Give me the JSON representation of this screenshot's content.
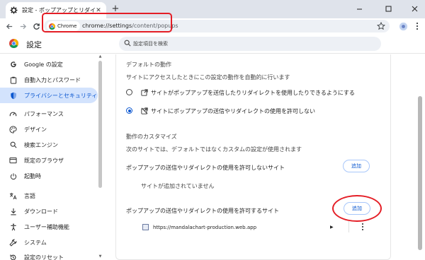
{
  "browser": {
    "tab_title": "設定 - ポップアップとリダイレクト",
    "omnibox_chip": "Chrome",
    "url_host": "chrome://settings",
    "url_path": "/content/popups"
  },
  "header": {
    "title": "設定",
    "search_placeholder": "設定項目を検索"
  },
  "sidebar": {
    "items": [
      {
        "label": "Google の設定",
        "icon": "google-g-icon"
      },
      {
        "label": "自動入力とパスワード",
        "icon": "clipboard-icon"
      },
      {
        "label": "プライバシーとセキュリティ",
        "icon": "shield-icon",
        "active": true
      },
      {
        "label": "パフォーマンス",
        "icon": "speedometer-icon"
      },
      {
        "label": "デザイン",
        "icon": "palette-icon"
      },
      {
        "label": "検索エンジン",
        "icon": "search-icon"
      },
      {
        "label": "既定のブラウザ",
        "icon": "browser-window-icon"
      },
      {
        "label": "起動時",
        "icon": "power-icon"
      },
      {
        "label": "言語",
        "icon": "translate-icon"
      },
      {
        "label": "ダウンロード",
        "icon": "download-icon"
      },
      {
        "label": "ユーザー補助機能",
        "icon": "accessibility-icon"
      },
      {
        "label": "システム",
        "icon": "wrench-icon"
      },
      {
        "label": "設定のリセット",
        "icon": "reset-icon"
      }
    ]
  },
  "main": {
    "default_behavior_heading": "デフォルトの動作",
    "default_behavior_desc": "サイトにアクセスしたときにこの設定の動作を自動的に行います",
    "option_allow": "サイトがポップアップを送信したりリダイレクトを使用したりできるようにする",
    "option_block": "サイトにポップアップの送信やリダイレクトの使用を許可しない",
    "selected_option": "block",
    "customize_heading": "動作のカスタマイズ",
    "customize_desc": "次のサイトでは、デフォルトではなくカスタムの設定が使用されます",
    "blocked_section_title": "ポップアップの送信やリダイレクトの使用を許可しないサイト",
    "blocked_add_label": "追加",
    "blocked_empty": "サイトが追加されていません",
    "allowed_section_title": "ポップアップの送信やリダイレクトの使用を許可するサイト",
    "allowed_add_label": "追加",
    "allowed_sites": [
      "https://mandalachart-production.web.app"
    ]
  },
  "colors": {
    "accent": "#0b57d0",
    "annotation_red": "#e41e26",
    "active_nav_bg": "#d3e3fd"
  }
}
